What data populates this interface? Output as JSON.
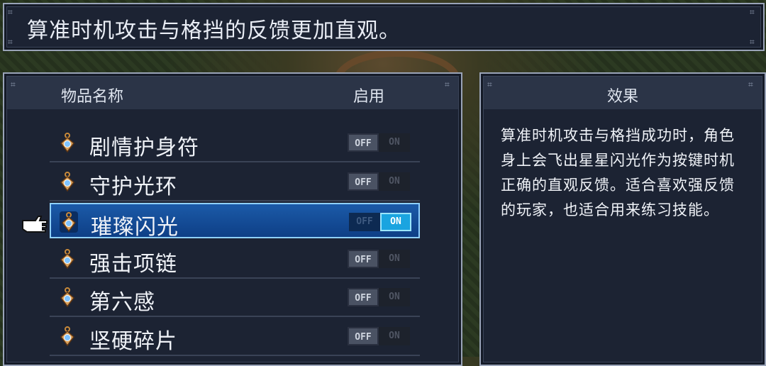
{
  "message": "算准时机攻击与格挡的反馈更加直观。",
  "list": {
    "header_name": "物品名称",
    "header_enable": "启用",
    "toggle_off_label": "OFF",
    "toggle_on_label": "ON",
    "items": [
      {
        "name": "剧情护身符",
        "enabled": false,
        "selected": false
      },
      {
        "name": "守护光环",
        "enabled": false,
        "selected": false
      },
      {
        "name": "璀璨闪光",
        "enabled": true,
        "selected": true
      },
      {
        "name": "强击项链",
        "enabled": false,
        "selected": false
      },
      {
        "name": "第六感",
        "enabled": false,
        "selected": false
      },
      {
        "name": "坚硬碎片",
        "enabled": false,
        "selected": false
      }
    ]
  },
  "effect": {
    "title": "效果",
    "description": "算准时机攻击与格挡成功时，角色身上会飞出星星闪光作为按键时机正确的直观反馈。适合喜欢强反馈的玩家，也适合用来练习技能。"
  },
  "icons": {
    "item": "amulet-icon",
    "cursor": "pointing-hand-cursor-icon",
    "corner": "corner-ornament-icon"
  },
  "colors": {
    "panel_bg": "#1c2333",
    "selected_row": "#1b5aa8",
    "toggle_on": "#1aa4e0"
  }
}
